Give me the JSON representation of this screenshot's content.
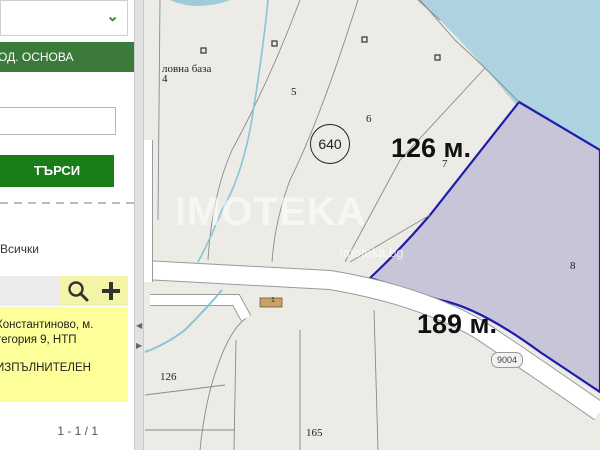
{
  "sidebar": {
    "layer_label": "ОД. ОСНОВА",
    "search_button": "ТЪРСИ",
    "search_value": "",
    "filter_label": "Всички",
    "result_lines": [
      "Константиново, м.",
      "тегория 9, НТП",
      "ИЗПЪЛНИТЕЛЕН"
    ],
    "pager": "1 - 1 / 1"
  },
  "map": {
    "place_label": "ловна база",
    "parcel_labels": [
      {
        "id": "parcel-4",
        "text": "4"
      },
      {
        "id": "parcel-5",
        "text": "5"
      },
      {
        "id": "parcel-6",
        "text": "6"
      },
      {
        "id": "parcel-7",
        "text": "7"
      },
      {
        "id": "parcel-8",
        "text": "8"
      },
      {
        "id": "parcel-126",
        "text": "126"
      },
      {
        "id": "parcel-165",
        "text": "165"
      }
    ],
    "block_number": "640",
    "building_number": "1",
    "road_number": "9004",
    "distance_top": "126 м.",
    "distance_bottom": "189 м.",
    "watermark": "IMOTEKA",
    "watermark_site": "imoteka.bg"
  },
  "colors": {
    "water": "#acd3df",
    "land": "#ecebe6",
    "parcel_fill": "#c8c5d9",
    "parcel_border": "#1d1dac",
    "road": "#ffffff",
    "stream": "#86c5d6",
    "sidebar_green": "#3c7a3c",
    "button_green": "#197d19",
    "result_highlight": "#ffff99",
    "building": "#c8a26a"
  },
  "icons": {
    "dropdown": "chevron-down-icon",
    "search": "search-icon",
    "add": "plus-icon"
  }
}
